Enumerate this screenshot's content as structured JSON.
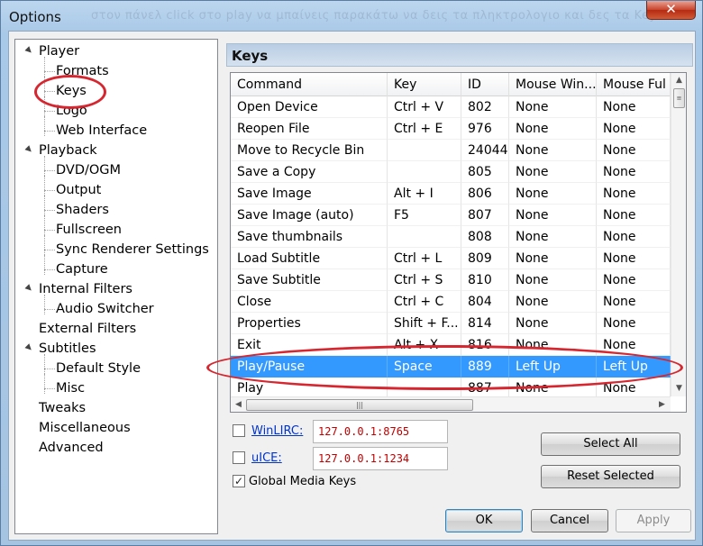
{
  "window": {
    "title": "Options",
    "watermark": "στον πάνελ click στο play να μπαίνεις παρακάτω να δεις τα πληκτρολογιο και δες τα Keys"
  },
  "tree": {
    "items": [
      {
        "label": "Player",
        "level": 0,
        "expander": "▲"
      },
      {
        "label": "Formats",
        "level": 1
      },
      {
        "label": "Keys",
        "level": 1
      },
      {
        "label": "Logo",
        "level": 1
      },
      {
        "label": "Web Interface",
        "level": 1
      },
      {
        "label": "Playback",
        "level": 0,
        "expander": "▲"
      },
      {
        "label": "DVD/OGM",
        "level": 1
      },
      {
        "label": "Output",
        "level": 1
      },
      {
        "label": "Shaders",
        "level": 1
      },
      {
        "label": "Fullscreen",
        "level": 1
      },
      {
        "label": "Sync Renderer Settings",
        "level": 1
      },
      {
        "label": "Capture",
        "level": 1
      },
      {
        "label": "Internal Filters",
        "level": 0,
        "expander": "▲"
      },
      {
        "label": "Audio Switcher",
        "level": 1
      },
      {
        "label": "External Filters",
        "level": 0
      },
      {
        "label": "Subtitles",
        "level": 0,
        "expander": "▲"
      },
      {
        "label": "Default Style",
        "level": 1
      },
      {
        "label": "Misc",
        "level": 1
      },
      {
        "label": "Tweaks",
        "level": 0
      },
      {
        "label": "Miscellaneous",
        "level": 0
      },
      {
        "label": "Advanced",
        "level": 0
      }
    ]
  },
  "panel": {
    "title": "Keys"
  },
  "table": {
    "columns": [
      "Command",
      "Key",
      "ID",
      "Mouse Win...",
      "Mouse Ful"
    ],
    "rows": [
      [
        "Open Device",
        "Ctrl + V",
        "802",
        "None",
        "None"
      ],
      [
        "Reopen File",
        "Ctrl + E",
        "976",
        "None",
        "None"
      ],
      [
        "Move to Recycle Bin",
        "",
        "24044",
        "None",
        "None"
      ],
      [
        "Save a Copy",
        "",
        "805",
        "None",
        "None"
      ],
      [
        "Save Image",
        "Alt + I",
        "806",
        "None",
        "None"
      ],
      [
        "Save Image (auto)",
        "F5",
        "807",
        "None",
        "None"
      ],
      [
        "Save thumbnails",
        "",
        "808",
        "None",
        "None"
      ],
      [
        "Load Subtitle",
        "Ctrl + L",
        "809",
        "None",
        "None"
      ],
      [
        "Save Subtitle",
        "Ctrl + S",
        "810",
        "None",
        "None"
      ],
      [
        "Close",
        "Ctrl + C",
        "804",
        "None",
        "None"
      ],
      [
        "Properties",
        "Shift + F...",
        "814",
        "None",
        "None"
      ],
      [
        "Exit",
        "Alt + X",
        "816",
        "None",
        "None"
      ],
      [
        "Play/Pause",
        "Space",
        "889",
        "Left Up",
        "Left Up"
      ],
      [
        "Play",
        "",
        "887",
        "None",
        "None"
      ]
    ],
    "selected_row": 12
  },
  "winlirc": {
    "label": "WinLIRC:",
    "value": "127.0.0.1:8765",
    "checked": false
  },
  "uice": {
    "label": "uICE:",
    "value": "127.0.0.1:1234",
    "checked": false
  },
  "global_media_keys": {
    "label": "Global Media Keys",
    "checked": true
  },
  "buttons": {
    "select_all": "Select All",
    "reset_selected": "Reset Selected",
    "ok": "OK",
    "cancel": "Cancel",
    "apply": "Apply"
  },
  "icons": {
    "close": "close-icon",
    "checkmark": "✓",
    "scroll_up": "▲",
    "scroll_down": "▼",
    "scroll_left": "◀",
    "scroll_right": "▶",
    "grip": "|||",
    "grip_h": "≡"
  },
  "colors": {
    "selection": "#3399ff",
    "annotation": "#d6262f",
    "ip_text": "#c00000"
  }
}
